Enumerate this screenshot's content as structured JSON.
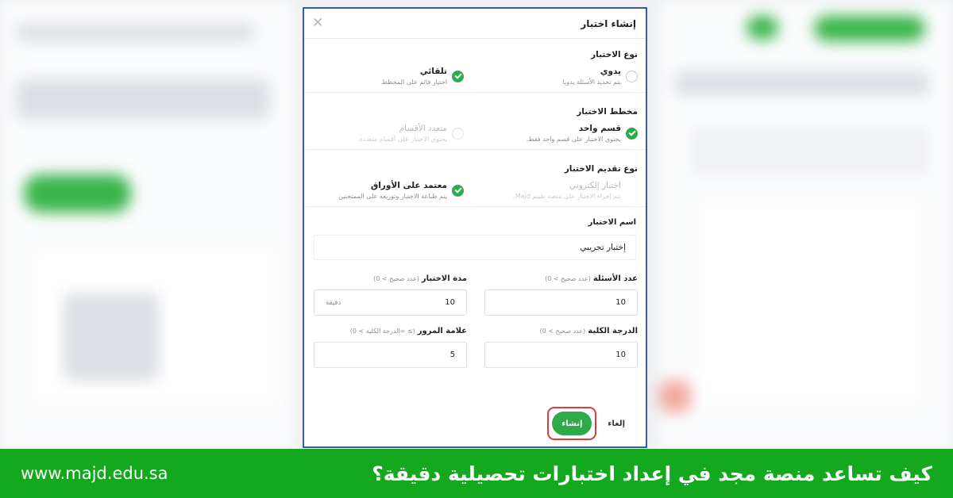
{
  "colors": {
    "accent": "#2eaa4a",
    "banner": "#14a81f",
    "highlight": "#e23b3b",
    "modal_border": "#3a5aa8"
  },
  "modal": {
    "title": "إنشاء اختبار",
    "close_icon": "close-icon",
    "exam_type": {
      "title": "نوع الاختبار",
      "options": [
        {
          "label": "يدوي",
          "desc": "يتم تحديد الأسئلة يدويا",
          "selected": false
        },
        {
          "label": "تلقائي",
          "desc": "اختيار قائم على المخطط",
          "selected": true
        }
      ]
    },
    "exam_plan": {
      "title": "مخطط الاختبار",
      "options": [
        {
          "label": "قسم واحد",
          "desc": "يحتوي الاختبار على قسم واحد فقط.",
          "selected": true
        },
        {
          "label": "متعدد الأقسام",
          "desc": "يحتوي الاختبار على أقسام متعددة.",
          "selected": false
        }
      ]
    },
    "delivery_type": {
      "title": "نوع تقديم الاختبار",
      "options": [
        {
          "label": "اختبار إلكتروني",
          "desc": "يتم إجراء الاختبار على منصة تقييم Majd.",
          "selected": false
        },
        {
          "label": "معتمد على الأوراق",
          "desc": "يتم طباعة الاختبار وتوزيعه على الممتحنين",
          "selected": true
        }
      ]
    },
    "exam_name": {
      "label": "اسم الاختبار",
      "value": "إختبار  تجريبي"
    },
    "question_count": {
      "label": "عدد الأسئلة",
      "hint": "(عدد صحيح > 0)",
      "value": "10"
    },
    "duration": {
      "label": "مدة الاختبار",
      "hint": "(عدد صحيح > 0)",
      "value": "10",
      "unit": "دقيقة"
    },
    "total_score": {
      "label": "الدرجة الكلية",
      "hint": "(عدد صحيح > 0)",
      "value": "10"
    },
    "pass_mark": {
      "label": "علامة المرور",
      "hint": "(≥ =الدرجة الكلية > 0)",
      "value": "5"
    },
    "create_label": "إنشاء",
    "cancel_label": "إلغاء"
  },
  "banner": {
    "headline": "كيف تساعد منصة مجد في إعداد اختبارات تحصيلية دقيقة؟",
    "url": "www.majd.edu.sa"
  }
}
